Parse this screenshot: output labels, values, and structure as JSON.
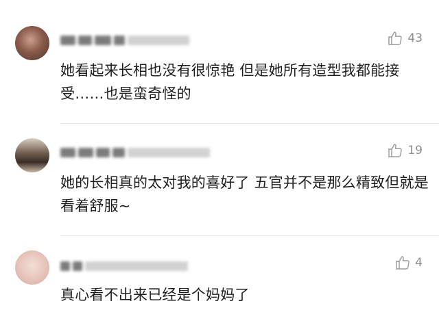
{
  "comments": [
    {
      "likes": "43",
      "text": "她看起来长相也没有很惊艳 但是她所有造型我都能接受……也是蛮奇怪的"
    },
    {
      "likes": "19",
      "text": "她的长相真的太对我的喜好了 五官并不是那么精致但就是看着舒服~"
    },
    {
      "likes": "4",
      "text": "真心看不出来已经是个妈妈了"
    }
  ],
  "icons": {
    "like": "thumbs-up-icon"
  },
  "colors": {
    "text": "#1f1f1f",
    "meta": "#8e8e8e",
    "divider": "#e9e9e9"
  }
}
